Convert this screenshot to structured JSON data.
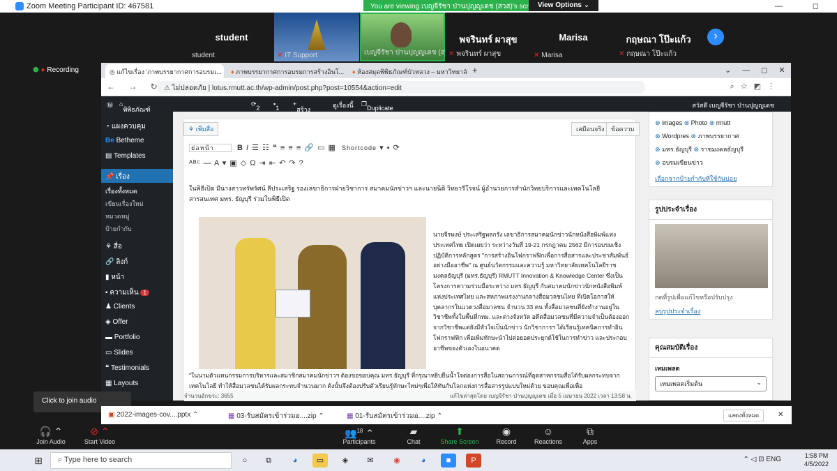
{
  "zoom": {
    "title": "Zoom Meeting Participant ID: 467581",
    "viewing": "You are viewing เบญจีรัชา ป่านปุญญเดช (สวส)'s screen",
    "view_options": "View Options ⌄",
    "tiles": [
      {
        "big": "student",
        "small": "student"
      },
      {
        "big": "",
        "small": "IT Support"
      },
      {
        "big": "",
        "small": "เบญจีรัชา ป่านปุญญเดช (สวส)"
      },
      {
        "big": "พจรินทร์ ผาสุข",
        "small": "พจรินทร์ ผาสุข"
      },
      {
        "big": "Marisa",
        "small": "Marisa"
      },
      {
        "big": "กฤษณา โป๊ะแก้ว",
        "small": "กฤษณา โป๊ะแก้ว"
      }
    ],
    "recording": "Recording",
    "tooltip": "Click to join audio",
    "controls": [
      {
        "label": "Join Audio",
        "icon": "headphones-icon"
      },
      {
        "label": "Start Video",
        "icon": "video-off-icon"
      },
      {
        "label": "Participants",
        "icon": "participants-icon",
        "count": "18"
      },
      {
        "label": "Chat",
        "icon": "chat-icon"
      },
      {
        "label": "Share Screen",
        "icon": "share-icon"
      },
      {
        "label": "Record",
        "icon": "record-icon"
      },
      {
        "label": "Reactions",
        "icon": "reactions-icon"
      },
      {
        "label": "Apps",
        "icon": "apps-icon"
      }
    ]
  },
  "browser": {
    "tabs": [
      "แก้ไขเรื่อง 'ภาพบรรยากาศการอบรมเ...",
      "ภาพบรรยากาศการอบรมการสร้างอินโ...",
      "ห้องสมุดพิพิธภัณฑ์บัวหลวง – มหาวิทยาลัยเท..."
    ],
    "not_secure": "ไม่ปลอดภัย",
    "url": "lotus.rmutt.ac.th/wp-admin/post.php?post=10554&action=edit",
    "wp_bar": {
      "site": "พิพิธภัณฑ์บัว มหาวิทยาลัยเทคโนโลยีราชมงค...",
      "updates": "2",
      "comments": "1",
      "new": "สร้างใหม่",
      "view": "ดูเรื่องนี้",
      "duplicate": "Duplicate Post",
      "greet": "สวัสดี เบญจีรัชา ป่านปุญญเดช"
    },
    "sidebar": [
      "แผงควบคุม",
      "Betheme",
      "Templates",
      "เรื่อง",
      "เรื่องทั้งหมด",
      "เขียนเรื่องใหม่",
      "หมวดหมู่",
      "ป้ายกำกับ",
      "สื่อ",
      "ลิงก์",
      "หน้า",
      "ความเห็น",
      "Clients",
      "Offer",
      "Portfolio",
      "Slides",
      "Testimonials",
      "Layouts"
    ],
    "comments_badge": "1",
    "editor": {
      "add_media": "เพิ่มสื่อ",
      "visual": "เสมือนจริง",
      "text": "ข้อความ",
      "format": "ย่อหน้า",
      "shortcode": "Shortcode",
      "para1": "ในพิธีเปิด มีนางสาวทรัพรัศน์ ลีประเสริฐ รองเลขาธิการฝ่ายวิชาการ สมาคมนักข่าวฯ และนายนิติ วิทยารีโรจน์ ผู้อำนวยการสำนักวิทยบริการและเทคโนโลยีสารสนเทศ มทร. ธัญบุรี ร่วมในพิธีเปิด",
      "para2": "นายจีรพงษ์ ประเสริฐพลกรัง เลขาธิการสมาคมนักข่าวนักหนังสือพิมพ์แห่งประเทศไทย เปิดเผยว่า ระหว่างวันที่ 19-21 กรกฎาคม 2562 มีการอบรมเชิงปฏิบัติการหลักสูตร \"การสร้างอินโฟกราฟฟิกเพื่อการสื่อสารและประชาสัมพันธ์อย่างมืออาชีพ\" ณ ศูนย์นวัตกรรมและความรู้ มหาวิทยาลัยเทคโนโลยีราชมงคลธัญบุรี (มทร.ธัญบุรี) RMUTT Innovation & Knowledge Center ซึ่งเป็นโครงการความร่วมมือระหว่าง มทร.ธัญบุรี กับสมาคมนักข่าวนักหนังสือพิมพ์แห่งประเทศไทย และสหภาพแรงงานกลางสื่อมวลชนไทย ที่เปิดโอกาสให้บุคลากรในแวดวงสื่อมวลชน จำนวน 33 คน ทั้งสื่อมวลชนที่ยังทำงานอยู่ในวิชาชีพทั้งในพื้นที่กทม. และต่างจังหวัด อดีตสื่อมวลชนที่มีความจำเป็นต้องออกจากวิชาชีพแต่ยังมีหัวใจเป็นนักข่าว นักวิชาการฯ ได้เรียนรู้เทคนิคการทำอินโฟกราฟฟิก เพื่อเพิ่มทักษะนำไปต่อยอดประยุกต์ใช้ในการทำข่าว และประกอบอาชีพของตัวเองในอนาคต",
      "para3": "\"ในนามตัวแทนกรรมการบริหารและสมาชิกสมาคมนักข่าวฯ ต้องขอขอบคุณ มทร.ธัญบุรี ที่กรุณาหยิบยื่นน้ำใจต่องการสื่อในสถานการณ์ที่อุตสาหกรรมสื่อได้รับผลกระทบจากเทคโนโลยี ทำให้สื่อมวลชนได้รับผลกระทบจำนวนมาก ดังนั้นจึงต้องปรับตัวเรียนรู้ทักษะใหม่ๆเพื่อให้ทันกับโลกแห่งการสื่อสารรูปแบบใหม่ด้วย ขอบคุณเพื่อเพื่อ",
      "path": "p",
      "word_count": "จำนวนอักขระ: 3655",
      "last_edit": "แก้ไขล่าสุดโดย เบญจีรัชา ป่านปุญญเดช เมื่อ 5 เมษายน 2022 เวลา 13:58 น."
    },
    "tags": [
      "images",
      "Photo",
      "rmutt",
      "Wordpres",
      "ภาพบรรยากาศ",
      "มทร.ธัญบุรี",
      "ราชมงคลธัญบุรี",
      "อบรมเขียนข่าว"
    ],
    "tags_link": "เลือกจากป้ายกำกับที่ใช้กันบ่อย",
    "featured": {
      "title": "รูปประจำเรื่อง",
      "hint": "กดที่รูปเพื่อแก้ไขหรือปรับปรุง",
      "remove": "ลบรูปประจำเรื่อง"
    },
    "props": {
      "title": "คุณสมบัติเรื่อง",
      "label": "เทมเพลต",
      "value": "เทมเพลตเริ่มต้น"
    }
  },
  "downloads": [
    "2022-images-cov....pptx",
    "03-รับสมัครเข้าร่วมอ....zip",
    "01-รับสมัครเข้าร่วมอ....zip"
  ],
  "downloads_show_all": "แสดงทั้งหมด",
  "taskbar": {
    "search": "Type here to search",
    "lang": "ENG",
    "time": "1:58 PM",
    "date": "4/5/2022"
  },
  "colors": {
    "zoom_blue": "#2d8cff",
    "wp_blue": "#2271b1",
    "viewing_green": "#2bb24c"
  }
}
